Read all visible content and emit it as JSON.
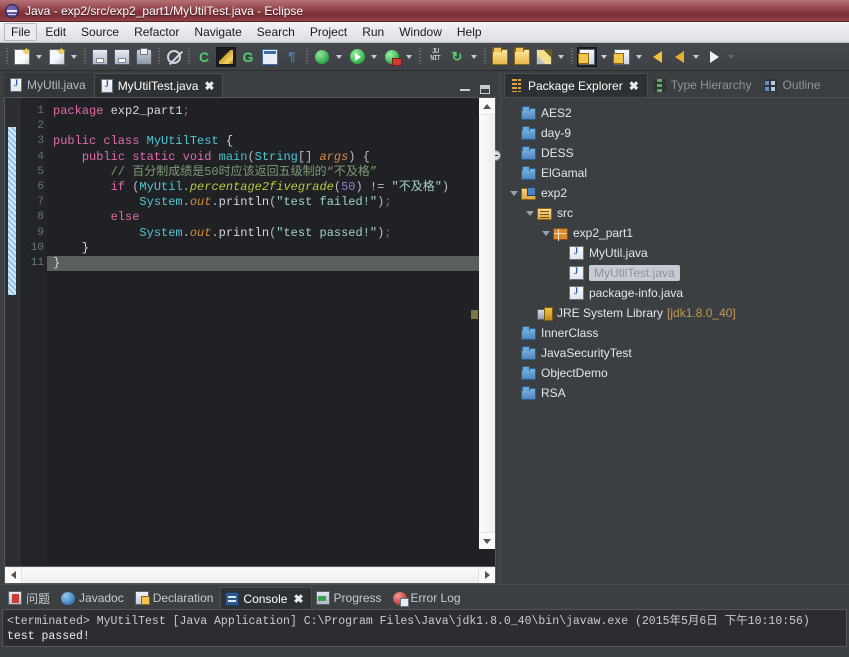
{
  "window": {
    "title": "Java - exp2/src/exp2_part1/MyUtilTest.java - Eclipse",
    "app_icon": "eclipse-icon"
  },
  "menubar": {
    "items": [
      {
        "label": "File",
        "active": true
      },
      {
        "label": "Edit",
        "active": false
      },
      {
        "label": "Source",
        "active": false
      },
      {
        "label": "Refactor",
        "active": false
      },
      {
        "label": "Navigate",
        "active": false
      },
      {
        "label": "Search",
        "active": false
      },
      {
        "label": "Project",
        "active": false
      },
      {
        "label": "Run",
        "active": false
      },
      {
        "label": "Window",
        "active": false
      },
      {
        "label": "Help",
        "active": false
      }
    ]
  },
  "toolbar": {
    "buttons": [
      {
        "name": "new-wizard",
        "icon": "new-document-icon"
      },
      {
        "name": "new-java-class",
        "icon": "new-class-icon"
      },
      {
        "name": "save",
        "icon": "save-icon"
      },
      {
        "name": "save-all",
        "icon": "save-all-icon"
      },
      {
        "name": "print",
        "icon": "print-icon"
      },
      {
        "name": "toggle-mark-occurrences",
        "icon": "mark-occurrences-icon"
      },
      {
        "name": "new-java-project",
        "icon": "java-project-icon"
      },
      {
        "name": "open-task",
        "icon": "open-task-icon"
      },
      {
        "name": "new-editor",
        "icon": "new-editor-icon"
      },
      {
        "name": "toggle-block-selection",
        "icon": "block-selection-icon"
      },
      {
        "name": "show-whitespace",
        "icon": "whitespace-icon"
      },
      {
        "name": "debug",
        "icon": "debug-icon"
      },
      {
        "name": "run",
        "icon": "run-icon"
      },
      {
        "name": "run-external-tools",
        "icon": "external-tools-icon"
      },
      {
        "name": "new-junit-test",
        "icon": "junit-icon"
      },
      {
        "name": "refresh-coverage",
        "icon": "coverage-icon"
      },
      {
        "name": "open-type",
        "icon": "open-type-icon"
      },
      {
        "name": "open-task-folder",
        "icon": "open-folder-icon"
      },
      {
        "name": "edit-highlight",
        "icon": "pencil-icon"
      },
      {
        "name": "previous-annotation",
        "icon": "previous-annotation-icon"
      },
      {
        "name": "next-annotation",
        "icon": "next-annotation-icon"
      },
      {
        "name": "back",
        "icon": "arrow-back-icon"
      },
      {
        "name": "back-alt",
        "icon": "arrow-back-icon"
      },
      {
        "name": "forward",
        "icon": "arrow-forward-icon"
      }
    ]
  },
  "editor": {
    "tabs": [
      {
        "label": "MyUtil.java",
        "active": false,
        "closable": false
      },
      {
        "label": "MyUtilTest.java",
        "active": true,
        "closable": true,
        "close_glyph": "✖"
      }
    ],
    "minimize_label": "Minimize",
    "maximize_label": "Maximize",
    "line_numbers": [
      "1",
      "2",
      "3",
      "4",
      "5",
      "6",
      "7",
      "8",
      "9",
      "10",
      "11"
    ],
    "cursor_line": 11,
    "code_lines": [
      {
        "n": 1,
        "tokens": [
          {
            "t": "package ",
            "c": "k"
          },
          {
            "t": "exp2_part1",
            "c": "plain"
          },
          {
            "t": ";",
            "c": "semi"
          }
        ]
      },
      {
        "n": 2,
        "tokens": []
      },
      {
        "n": 3,
        "tokens": [
          {
            "t": "public class ",
            "c": "k"
          },
          {
            "t": "MyUtilTest",
            "c": "cls"
          },
          {
            "t": " {",
            "c": "plain"
          }
        ]
      },
      {
        "n": 4,
        "tokens": [
          {
            "t": "    ",
            "c": "plain"
          },
          {
            "t": "public static void ",
            "c": "k"
          },
          {
            "t": "main",
            "c": "cls2"
          },
          {
            "t": "(",
            "c": "op"
          },
          {
            "t": "String",
            "c": "cls"
          },
          {
            "t": "[] ",
            "c": "op"
          },
          {
            "t": "args",
            "c": "param"
          },
          {
            "t": ") {",
            "c": "op"
          }
        ]
      },
      {
        "n": 5,
        "tokens": [
          {
            "t": "        ",
            "c": "plain"
          },
          {
            "t": "// 百分制成绩是50时应该返回五级制的“不及格”",
            "c": "cmt"
          }
        ]
      },
      {
        "n": 6,
        "tokens": [
          {
            "t": "        ",
            "c": "plain"
          },
          {
            "t": "if ",
            "c": "k"
          },
          {
            "t": "(",
            "c": "op"
          },
          {
            "t": "MyUtil",
            "c": "cls"
          },
          {
            "t": ".",
            "c": "op"
          },
          {
            "t": "percentage2fivegrade",
            "c": "mth"
          },
          {
            "t": "(",
            "c": "op"
          },
          {
            "t": "50",
            "c": "num"
          },
          {
            "t": ") != ",
            "c": "op"
          },
          {
            "t": "\"不及格\"",
            "c": "str"
          },
          {
            "t": ")",
            "c": "op"
          }
        ]
      },
      {
        "n": 7,
        "tokens": [
          {
            "t": "            ",
            "c": "plain"
          },
          {
            "t": "System",
            "c": "cls"
          },
          {
            "t": ".",
            "c": "op"
          },
          {
            "t": "out",
            "c": "fld2"
          },
          {
            "t": ".",
            "c": "op"
          },
          {
            "t": "println",
            "c": "plain"
          },
          {
            "t": "(",
            "c": "op"
          },
          {
            "t": "\"test failed!\"",
            "c": "str"
          },
          {
            "t": ")",
            "c": "op"
          },
          {
            "t": ";",
            "c": "semi"
          }
        ]
      },
      {
        "n": 8,
        "tokens": [
          {
            "t": "        ",
            "c": "plain"
          },
          {
            "t": "else",
            "c": "k"
          }
        ]
      },
      {
        "n": 9,
        "tokens": [
          {
            "t": "            ",
            "c": "plain"
          },
          {
            "t": "System",
            "c": "cls"
          },
          {
            "t": ".",
            "c": "op"
          },
          {
            "t": "out",
            "c": "fld2"
          },
          {
            "t": ".",
            "c": "op"
          },
          {
            "t": "println",
            "c": "plain"
          },
          {
            "t": "(",
            "c": "op"
          },
          {
            "t": "\"test passed!\"",
            "c": "str"
          },
          {
            "t": ")",
            "c": "op"
          },
          {
            "t": ";",
            "c": "semi"
          }
        ]
      },
      {
        "n": 10,
        "tokens": [
          {
            "t": "    }",
            "c": "plain"
          }
        ]
      },
      {
        "n": 11,
        "tokens": [
          {
            "t": "}",
            "c": "plain"
          }
        ]
      }
    ]
  },
  "explorer": {
    "tabs": [
      {
        "label": "Package Explorer",
        "active": true,
        "icon": "package-explorer-icon",
        "close_glyph": "✖"
      },
      {
        "label": "Type Hierarchy",
        "active": false,
        "icon": "type-hierarchy-icon"
      },
      {
        "label": "Outline",
        "active": false,
        "icon": "outline-icon"
      }
    ],
    "tree": [
      {
        "label": "AES2",
        "icon": "folder-icon",
        "indent": 1,
        "twisty": "none",
        "selected": false
      },
      {
        "label": "day-9",
        "icon": "folder-icon",
        "indent": 1,
        "twisty": "none",
        "selected": false
      },
      {
        "label": "DESS",
        "icon": "folder-icon",
        "indent": 1,
        "twisty": "none",
        "selected": false
      },
      {
        "label": "ElGamal",
        "icon": "folder-icon",
        "indent": 1,
        "twisty": "none",
        "selected": false
      },
      {
        "label": "exp2",
        "icon": "java-project-icon",
        "indent": 1,
        "twisty": "open",
        "selected": false
      },
      {
        "label": "src",
        "icon": "source-folder-icon",
        "indent": 2,
        "twisty": "open",
        "selected": false
      },
      {
        "label": "exp2_part1",
        "icon": "package-icon",
        "indent": 3,
        "twisty": "open",
        "selected": false
      },
      {
        "label": "MyUtil.java",
        "icon": "java-file-icon",
        "indent": 4,
        "twisty": "none",
        "selected": false
      },
      {
        "label": "MyUtilTest.java",
        "icon": "java-file-icon",
        "indent": 4,
        "twisty": "none",
        "selected": true
      },
      {
        "label": "package-info.java",
        "icon": "java-file-icon",
        "indent": 4,
        "twisty": "none",
        "selected": false
      },
      {
        "label": "JRE System Library",
        "sublabel": "[jdk1.8.0_40]",
        "icon": "jre-library-icon",
        "indent": 2,
        "twisty": "none",
        "selected": false
      },
      {
        "label": "InnerClass",
        "icon": "folder-icon",
        "indent": 1,
        "twisty": "none",
        "selected": false
      },
      {
        "label": "JavaSecurityTest",
        "icon": "folder-icon",
        "indent": 1,
        "twisty": "none",
        "selected": false
      },
      {
        "label": "ObjectDemo",
        "icon": "folder-icon",
        "indent": 1,
        "twisty": "none",
        "selected": false
      },
      {
        "label": "RSA",
        "icon": "folder-icon",
        "indent": 1,
        "twisty": "none",
        "selected": false
      }
    ]
  },
  "bottom": {
    "tabs": [
      {
        "label": "问题",
        "active": false,
        "icon": "problems-icon"
      },
      {
        "label": "Javadoc",
        "active": false,
        "icon": "javadoc-icon"
      },
      {
        "label": "Declaration",
        "active": false,
        "icon": "declaration-icon"
      },
      {
        "label": "Console",
        "active": true,
        "icon": "console-icon",
        "close_glyph": "✖"
      },
      {
        "label": "Progress",
        "active": false,
        "icon": "progress-icon"
      },
      {
        "label": "Error Log",
        "active": false,
        "icon": "error-log-icon"
      }
    ],
    "console": {
      "header": "<terminated> MyUtilTest [Java Application] C:\\Program Files\\Java\\jdk1.8.0_40\\bin\\javaw.exe (2015年5月6日 下午10:10:56)",
      "output": "test passed!"
    }
  },
  "colors": {
    "titlebar": "#8e3b42",
    "menubar": "#e7e9ed",
    "toolbar": "#43464a",
    "editor_bg": "#1f2124",
    "panel_bg": "#3c3f41",
    "tab_active": "#2e3134",
    "selection": "#c8ccd2",
    "change_bar": "#8fc6f0"
  }
}
